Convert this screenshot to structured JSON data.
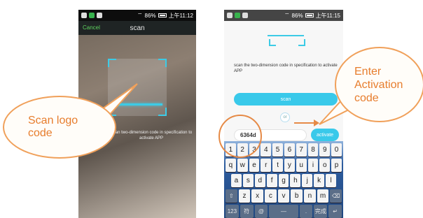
{
  "left_phone": {
    "status": {
      "signal": "86%",
      "time": "上午11:12"
    },
    "topbar": {
      "cancel": "Cancel",
      "title": "scan"
    },
    "instructions": "Scan two-dimension code in specification to activate APP"
  },
  "right_phone": {
    "status": {
      "signal": "86%",
      "time": "上午11:15"
    },
    "instructions": "scan the two-dimension code in specification to activate APP",
    "scan_button": "scan",
    "or_label": "or",
    "code_value": "6364d",
    "activate_button": "activate",
    "keyboard": {
      "row1": [
        "1",
        "2",
        "3",
        "4",
        "5",
        "6",
        "7",
        "8",
        "9",
        "0"
      ],
      "row2": [
        "q",
        "w",
        "e",
        "r",
        "t",
        "y",
        "u",
        "i",
        "o",
        "p"
      ],
      "row3": [
        "a",
        "s",
        "d",
        "f",
        "g",
        "h",
        "j",
        "k",
        "l"
      ],
      "row4": [
        "⇧",
        "z",
        "x",
        "c",
        "v",
        "b",
        "n",
        "m",
        "⌫"
      ],
      "row5": [
        "123",
        "符",
        "@",
        "—",
        ".",
        "完成",
        "↵"
      ]
    }
  },
  "callouts": {
    "left": "Scan logo code",
    "right": "Enter Activation code"
  },
  "colors": {
    "accent": "#39c9ea",
    "callout": "#e77d2d"
  },
  "icons": [
    "wifi-icon",
    "battery-icon",
    "scan-corner-icon"
  ]
}
